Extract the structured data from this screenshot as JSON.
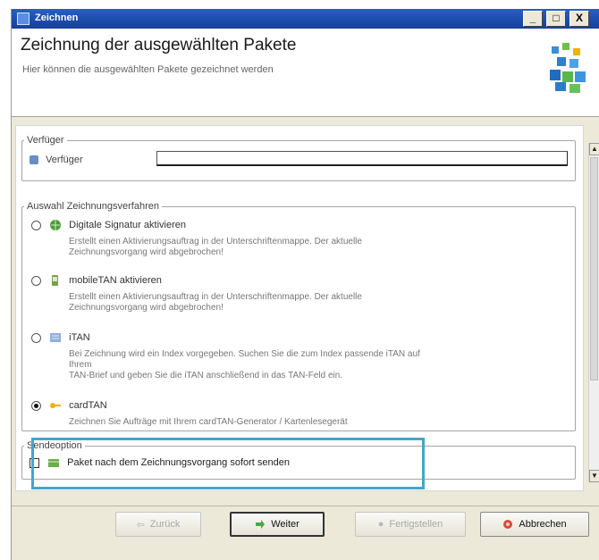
{
  "window": {
    "title": "Zeichnen",
    "minimize_label": "_",
    "maximize_label": "□",
    "close_label": "X"
  },
  "header": {
    "title": "Zeichnung der ausgewählten Pakete",
    "subtitle": "Hier können die ausgewählten Pakete gezeichnet werden"
  },
  "verfuger": {
    "legend": "Verfüger",
    "field_label": "Verfüger",
    "field_value": ""
  },
  "auswahl": {
    "legend": "Auswahl Zeichnungsverfahren",
    "options": [
      {
        "label": "Digitale Signatur aktivieren",
        "desc1": "Erstellt einen Aktivierungsauftrag in der Unterschriftenmappe. Der aktuelle",
        "desc2": "Zeichnungsvorgang wird abgebrochen!",
        "icon": "globe-signature-icon",
        "selected": false
      },
      {
        "label": "mobileTAN aktivieren",
        "desc1": "Erstellt einen Aktivierungsauftrag in der Unterschriftenmappe. Der aktuelle",
        "desc2": "Zeichnungsvorgang wird abgebrochen!",
        "icon": "mobile-phone-icon",
        "selected": false
      },
      {
        "label": "iTAN",
        "desc1": "Bei Zeichnung wird ein Index vorgegeben. Suchen Sie die zum Index passende iTAN auf",
        "desc2": "Ihrem",
        "desc3": "TAN-Brief und geben Sie die iTAN anschließend in das TAN-Feld ein.",
        "icon": "tan-letter-icon",
        "selected": false
      },
      {
        "label": "cardTAN",
        "desc1": "Zeichnen Sie Aufträge mit Ihrem cardTAN-Generator / Kartenlesegerät",
        "icon": "key-icon",
        "selected": true
      }
    ]
  },
  "sendeoption": {
    "legend": "Sendeoption",
    "checkbox_label": "Paket nach dem Zeichnungsvorgang sofort senden",
    "checked": false
  },
  "buttons": {
    "back": "Zurück",
    "next": "Weiter",
    "finish": "Fertigstellen",
    "cancel": "Abbrechen"
  },
  "colors": {
    "titlebar": "#1d4fae",
    "highlight": "#42a7c9",
    "dialog_bg": "#ece9d8"
  }
}
